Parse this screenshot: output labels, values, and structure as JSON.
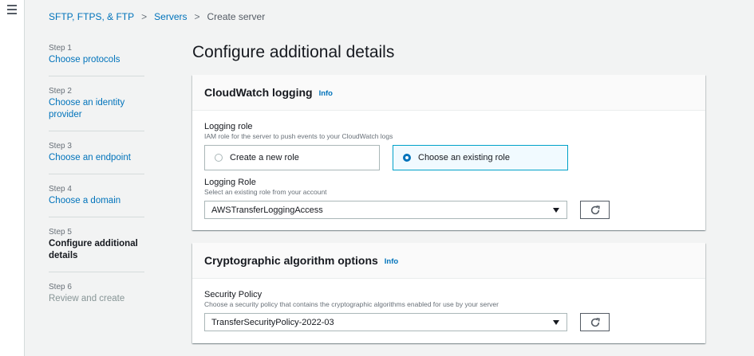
{
  "breadcrumb": {
    "items": [
      "SFTP, FTPS, & FTP",
      "Servers"
    ],
    "current": "Create server"
  },
  "steps": [
    {
      "number": "Step 1",
      "label": "Choose protocols",
      "state": "link"
    },
    {
      "number": "Step 2",
      "label": "Choose an identity provider",
      "state": "link"
    },
    {
      "number": "Step 3",
      "label": "Choose an endpoint",
      "state": "link"
    },
    {
      "number": "Step 4",
      "label": "Choose a domain",
      "state": "link"
    },
    {
      "number": "Step 5",
      "label": "Configure additional details",
      "state": "current"
    },
    {
      "number": "Step 6",
      "label": "Review and create",
      "state": "disabled"
    }
  ],
  "page_title": "Configure additional details",
  "cloudwatch": {
    "title": "CloudWatch logging",
    "info": "Info",
    "logging_role_label": "Logging role",
    "logging_role_desc": "IAM role for the server to push events to your CloudWatch logs",
    "options": [
      "Create a new role",
      "Choose an existing role"
    ],
    "selected_option": "Choose an existing role",
    "role_select_label": "Logging Role",
    "role_select_desc": "Select an existing role from your account",
    "role_select_value": "AWSTransferLoggingAccess"
  },
  "crypto": {
    "title": "Cryptographic algorithm options",
    "info": "Info",
    "policy_label": "Security Policy",
    "policy_desc": "Choose a security policy that contains the cryptographic algorithms enabled for use by your server",
    "policy_value": "TransferSecurityPolicy-2022-03"
  },
  "icons": {
    "menu": "hamburger-menu-icon",
    "separator": "chevron-right-icon",
    "dropdown": "caret-down-icon",
    "refresh": "refresh-icon"
  },
  "colors": {
    "link": "#0073bb",
    "selected_tile_border": "#00a1c9",
    "background": "#f2f3f3"
  }
}
